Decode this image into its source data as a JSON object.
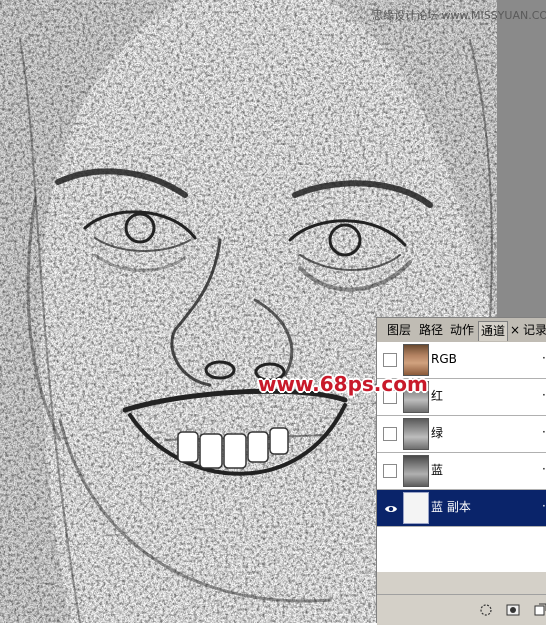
{
  "watermark": {
    "site_top": "思缘设计论坛 www.MISSYUAN.COM",
    "site_mid": "www.68ps.com"
  },
  "channels_panel": {
    "tabs": [
      "图层",
      "路径",
      "动作",
      "通道",
      "×",
      "记录"
    ],
    "active_tab": "通道",
    "channels": [
      {
        "name": "RGB",
        "visible": false,
        "selected": false,
        "thumb": "color",
        "shortcut": "·"
      },
      {
        "name": "红",
        "visible": false,
        "selected": false,
        "thumb": "gray",
        "shortcut": "·"
      },
      {
        "name": "绿",
        "visible": false,
        "selected": false,
        "thumb": "gray",
        "shortcut": "·"
      },
      {
        "name": "蓝",
        "visible": false,
        "selected": false,
        "thumb": "gray2",
        "shortcut": "·"
      },
      {
        "name": "蓝 副本",
        "visible": true,
        "selected": true,
        "thumb": "sketch",
        "shortcut": "·"
      }
    ]
  },
  "colors": {
    "panel_bg": "#d4d0c8",
    "selection": "#0a246a",
    "watermark_red": "#c8192a"
  },
  "icons": {
    "eye": "eye-icon",
    "load_selection": "dotted-circle-icon",
    "save_selection": "mask-icon",
    "new_channel": "new-channel-icon"
  }
}
